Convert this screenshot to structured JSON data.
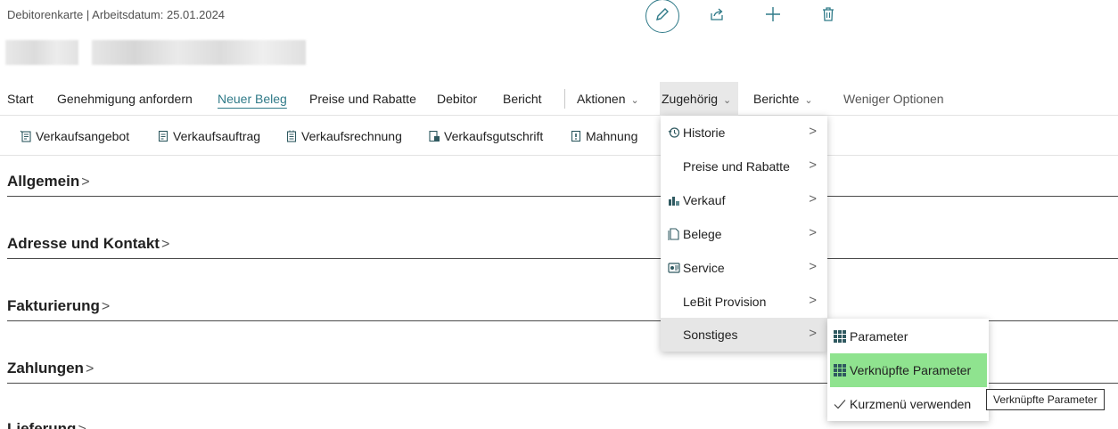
{
  "header": {
    "breadcrumb": "Debitorenkarte | Arbeitsdatum: 25.01.2024"
  },
  "top_actions": [
    "edit-icon",
    "share-icon",
    "new-icon",
    "delete-icon"
  ],
  "menubar": {
    "items": [
      {
        "label": "Start"
      },
      {
        "label": "Genehmigung anfordern"
      },
      {
        "label": "Neuer Beleg"
      },
      {
        "label": "Preise und Rabatte"
      },
      {
        "label": "Debitor"
      },
      {
        "label": "Bericht"
      },
      {
        "label": "Aktionen"
      },
      {
        "label": "Zugehörig"
      },
      {
        "label": "Berichte"
      },
      {
        "label": "Weniger Optionen"
      }
    ]
  },
  "subbar": {
    "items": [
      {
        "label": "Verkaufsangebot"
      },
      {
        "label": "Verkaufsauftrag"
      },
      {
        "label": "Verkaufsrechnung"
      },
      {
        "label": "Verkaufsgutschrift"
      },
      {
        "label": "Mahnung"
      }
    ]
  },
  "sections": [
    {
      "title": "Allgemein"
    },
    {
      "title": "Adresse und Kontakt"
    },
    {
      "title": "Fakturierung"
    },
    {
      "title": "Zahlungen"
    },
    {
      "title": "Lieferung"
    }
  ],
  "dropdown_zugehoerig": {
    "items": [
      {
        "label": "Historie",
        "icon": "history-icon"
      },
      {
        "label": "Preise und Rabatte",
        "icon": ""
      },
      {
        "label": "Verkauf",
        "icon": "sales-icon"
      },
      {
        "label": "Belege",
        "icon": "document-icon"
      },
      {
        "label": "Service",
        "icon": "service-icon"
      },
      {
        "label": "LeBit Provision",
        "icon": ""
      },
      {
        "label": "Sonstiges",
        "icon": ""
      }
    ]
  },
  "submenu_sonstiges": {
    "items": [
      {
        "label": "Parameter",
        "icon": "grid-icon"
      },
      {
        "label": "Verknüpfte Parameter",
        "icon": "grid-icon"
      },
      {
        "label": "Kurzmenü verwenden",
        "icon": "checkmark-icon"
      }
    ]
  },
  "tooltip": "Verknüpfte Parameter",
  "colors": {
    "accent": "#2f7a88",
    "hover_highlight": "#8fe38f"
  }
}
